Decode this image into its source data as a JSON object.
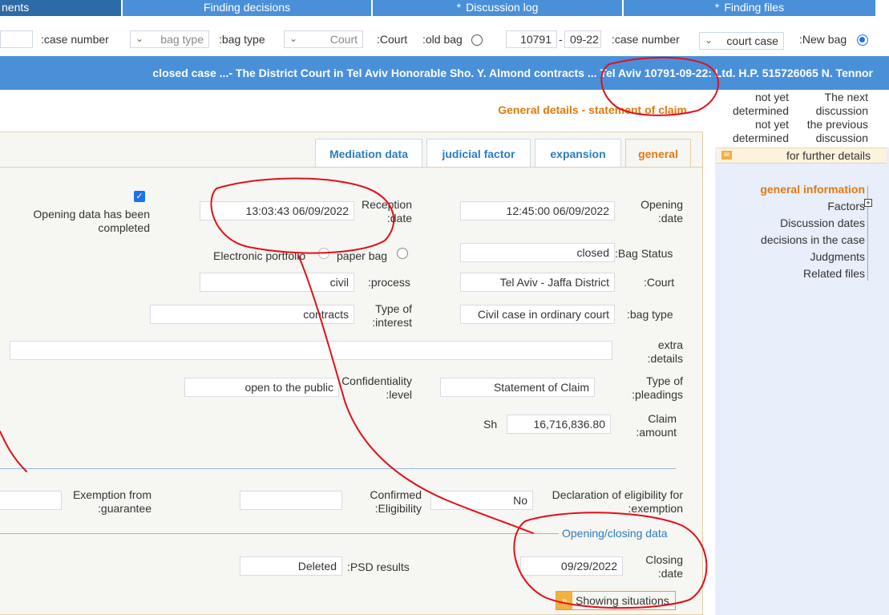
{
  "top_tabs": [
    {
      "label": "nents",
      "starred": false,
      "active": true
    },
    {
      "label": "Finding decisions",
      "starred": false,
      "active": false
    },
    {
      "label": "Discussion log",
      "starred": true,
      "active": false
    },
    {
      "label": "Finding files",
      "starred": true,
      "active": false
    }
  ],
  "search": {
    "case_number_label_1": ":case number",
    "bag_type_placeholder": "bag type",
    "bag_type_label": ":bag type",
    "court_placeholder": "Court",
    "court_label": ":Court",
    "old_bag_label": ":old bag",
    "case_num_part1": "10791",
    "case_num_dash": "-",
    "case_num_part2": "09-22",
    "case_number_label_2": ":case number",
    "court_case_select": "court case",
    "new_bag_label": ":New bag"
  },
  "case_band": {
    "text": "closed case ...- The District Court in Tel Aviv Honorable Sho. Y. Almond contracts ... Tel Aviv 10791-09-22: Ltd. H.P. 515726065 N. Tennor"
  },
  "main": {
    "section_title": "General details - statement of claim",
    "tabs": [
      {
        "label": "Mediation data",
        "active": false
      },
      {
        "label": "judicial factor",
        "active": false
      },
      {
        "label": "expansion",
        "active": false
      },
      {
        "label": "general",
        "active": true
      }
    ],
    "opening_completed_label_1": "Opening data has been",
    "opening_completed_label_2": "completed",
    "reception_date_value": "13:03:43 06/09/2022",
    "reception_date_label_1": "Reception",
    "reception_date_label_2": ":date",
    "opening_date_value": "12:45:00 06/09/2022",
    "opening_date_label_1": "Opening",
    "opening_date_label_2": ":date",
    "electronic_portfolio_label": "Electronic portfolio",
    "paper_bag_label": "paper bag",
    "bag_status_value": "closed",
    "bag_status_label": ":Bag Status",
    "process_value": "civil",
    "process_label": ":process",
    "court_value": "Tel Aviv - Jaffa District",
    "court_label": ":Court",
    "interest_value": "contracts",
    "interest_label_1": "Type of",
    "interest_label_2": ":interest",
    "bag_type_value": "Civil case in ordinary court",
    "bag_type_label": ":bag type",
    "extra_details_value": "",
    "extra_details_label_1": "extra",
    "extra_details_label_2": ":details",
    "confidentiality_value": "open to the public",
    "confidentiality_label_1": "Confidentiality",
    "confidentiality_label_2": ":level",
    "pleadings_value": "Statement of Claim",
    "pleadings_label_1": "Type of",
    "pleadings_label_2": ":pleadings",
    "currency": "Sh",
    "claim_amount_value": "16,716,836.80",
    "claim_amount_label_1": "Claim",
    "claim_amount_label_2": ":amount",
    "exemption_guarantee_label_1": "Exemption from",
    "exemption_guarantee_label_2": ":guarantee",
    "exemption_guarantee_value": "",
    "confirmed_eligibility_label_1": "Confirmed",
    "confirmed_eligibility_label_2": ":Eligibility",
    "confirmed_eligibility_value": "",
    "declaration_value": "No",
    "declaration_label_1": "Declaration of eligibility for",
    "declaration_label_2": ":exemption",
    "opening_closing_section": "Opening/closing data",
    "psd_value": "Deleted",
    "psd_label": ":PSD results",
    "closing_date_value": "09/29/2022",
    "closing_date_label_1": "Closing",
    "closing_date_label_2": ":date",
    "showing_situations": "Showing situations"
  },
  "sidebar": {
    "not_yet_1": "not yet",
    "determined_1": "determined",
    "next_1": "The next",
    "discussion_1": "discussion",
    "not_yet_2": "not yet",
    "determined_2": "determined",
    "previous": "the previous",
    "discussion_2": "discussion",
    "further_details": "for further details",
    "nav": [
      {
        "label": "general information",
        "active": true
      },
      {
        "label": "Factors",
        "active": false
      },
      {
        "label": "Discussion dates",
        "active": false
      },
      {
        "label": "decisions in the case",
        "active": false
      },
      {
        "label": "Judgments",
        "active": false
      },
      {
        "label": "Related files",
        "active": false
      }
    ]
  },
  "colors": {
    "header_blue": "#4a90d9",
    "accent_orange": "#e07a10",
    "link_blue": "#2c7cc1",
    "annotation_red": "#e0101a"
  },
  "icons": [
    "chevron-down-icon",
    "checkbox-checked-icon",
    "radio-on-icon",
    "radio-off-icon",
    "envelope-icon",
    "plus-icon",
    "double-chevron-down-icon"
  ]
}
